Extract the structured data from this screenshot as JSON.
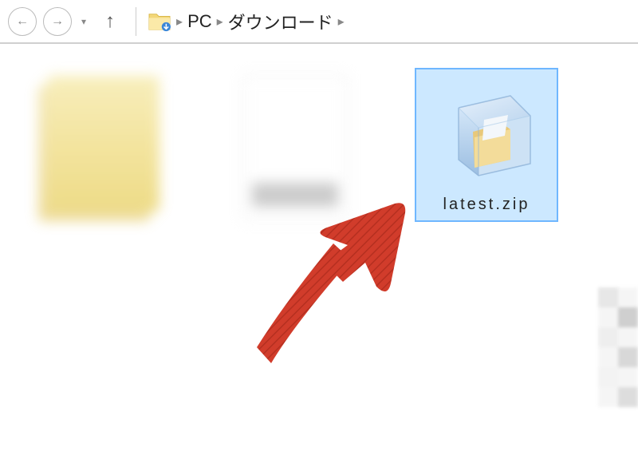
{
  "nav": {
    "back_glyph": "←",
    "forward_glyph": "→",
    "up_glyph": "↑",
    "dropdown_glyph": "▾"
  },
  "breadcrumb": {
    "segments": [
      "PC",
      "ダウンロード"
    ],
    "separator": "▸"
  },
  "files": [
    {
      "name": "",
      "selected": false,
      "kind": "folders-blur"
    },
    {
      "name": "",
      "selected": false,
      "kind": "doc-blur"
    },
    {
      "name": "latest.zip",
      "selected": true,
      "kind": "zip"
    }
  ],
  "annotation": {
    "arrow_color": "#d13c2b"
  }
}
